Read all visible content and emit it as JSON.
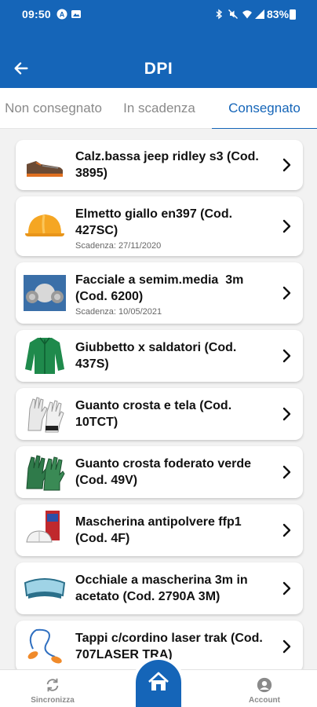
{
  "status_bar": {
    "time": "09:50",
    "battery": "83%",
    "icons": [
      "notification-a-icon",
      "gallery-icon",
      "bluetooth-icon",
      "mute-icon",
      "wifi-icon",
      "signal-icon",
      "battery-icon"
    ]
  },
  "app_bar": {
    "title": "DPI",
    "back_icon": "arrow-left-icon"
  },
  "tabs": [
    {
      "label": "Non consegnato",
      "active": false
    },
    {
      "label": "In scadenza",
      "active": false
    },
    {
      "label": "Consegnato",
      "active": true
    }
  ],
  "items": [
    {
      "name": "Calz.bassa jeep ridley s3 (Cod. 3895)",
      "sub": "",
      "thumb": "safety-shoe-icon"
    },
    {
      "name": "Elmetto giallo en397 (Cod. 427SC)",
      "sub": "Scadenza: 27/11/2020",
      "thumb": "yellow-helmet-icon"
    },
    {
      "name": "Facciale a semim.media  3m (Cod. 6200)",
      "sub": "Scadenza: 10/05/2021",
      "thumb": "half-mask-respirator-icon"
    },
    {
      "name": "Giubbetto x saldatori (Cod. 437S)",
      "sub": "",
      "thumb": "green-jacket-icon"
    },
    {
      "name": "Guanto crosta e tela (Cod. 10TCT)",
      "sub": "",
      "thumb": "work-gloves-icon"
    },
    {
      "name": "Guanto crosta foderato verde (Cod. 49V)",
      "sub": "",
      "thumb": "green-gloves-icon"
    },
    {
      "name": "Mascherina antipolvere ffp1 (Cod. 4F)",
      "sub": "",
      "thumb": "dust-mask-icon"
    },
    {
      "name": "Occhiale a mascherina 3m in acetato (Cod. 2790A 3M)",
      "sub": "",
      "thumb": "safety-goggles-icon"
    },
    {
      "name": "Tappi c/cordino laser trak (Cod. 707LASER TRA)",
      "sub": "",
      "thumb": "corded-earplugs-icon"
    }
  ],
  "bottom_nav": {
    "sync_label": "Sincronizza",
    "account_label": "Account",
    "home_icon": "home-icon"
  },
  "colors": {
    "primary": "#1565b8",
    "background": "#f2f2f2",
    "inactive": "#8a8a8a"
  }
}
